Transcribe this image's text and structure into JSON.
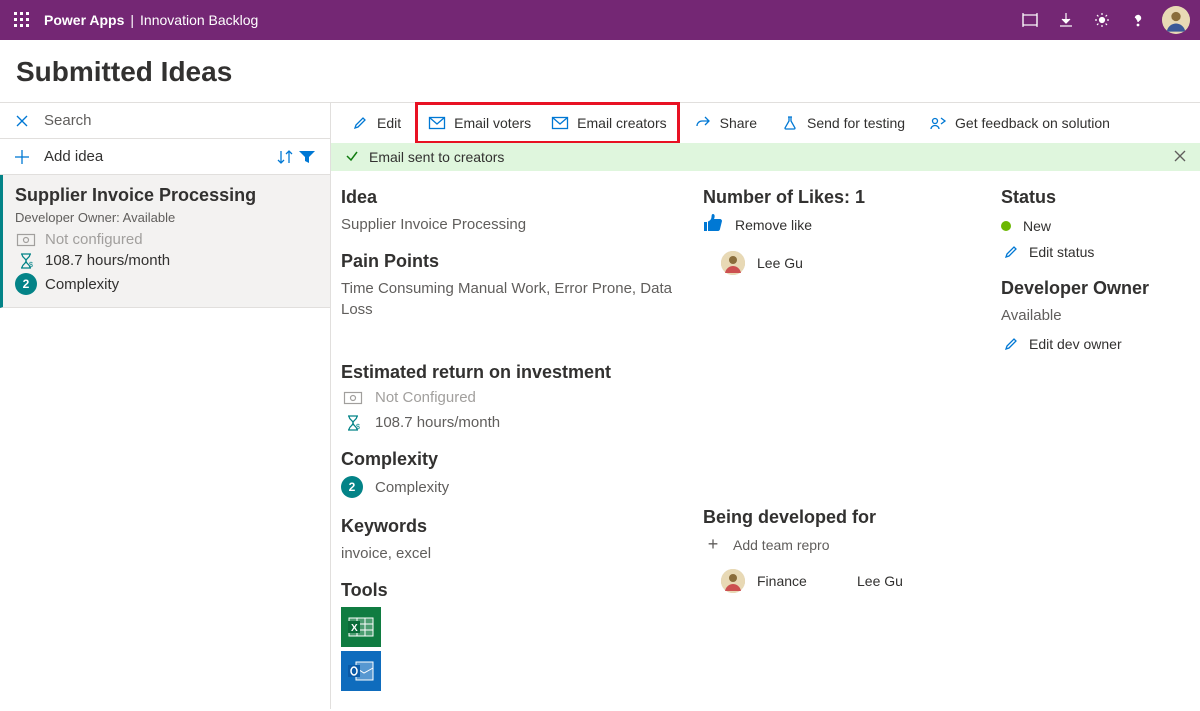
{
  "header": {
    "brand": "Power Apps",
    "app_name": "Innovation Backlog"
  },
  "page_title": "Submitted Ideas",
  "sidebar": {
    "search_placeholder": "Search",
    "add_label": "Add idea",
    "cards": [
      {
        "title": "Supplier Invoice Processing",
        "owner": "Developer Owner: Available",
        "cost": "Not configured",
        "hours": "108.7 hours/month",
        "complexity_n": "2",
        "complexity_label": "Complexity"
      }
    ]
  },
  "commands": {
    "edit": "Edit",
    "email_voters": "Email voters",
    "email_creators": "Email creators",
    "share": "Share",
    "send_for_testing": "Send for testing",
    "get_feedback": "Get feedback on solution"
  },
  "banner": {
    "text": "Email sent to creators"
  },
  "detail": {
    "idea_h": "Idea",
    "idea_v": "Supplier Invoice Processing",
    "pain_h": "Pain Points",
    "pain_v": "Time Consuming Manual Work, Error Prone, Data Loss",
    "roi_h": "Estimated return on investment",
    "roi_cost": "Not Configured",
    "roi_hours": "108.7 hours/month",
    "complex_h": "Complexity",
    "complex_n": "2",
    "complex_v": "Complexity",
    "keywords_h": "Keywords",
    "keywords_v": "invoice, excel",
    "tools_h": "Tools",
    "likes_h": "Number of Likes: 1",
    "remove_like": "Remove like",
    "liker": "Lee Gu",
    "developed_h": "Being developed for",
    "add_team": "Add team repro",
    "dev_team": "Finance",
    "dev_person": "Lee Gu",
    "status_h": "Status",
    "status_v": "New",
    "edit_status": "Edit status",
    "owner_h": "Developer Owner",
    "owner_v": "Available",
    "edit_owner": "Edit dev owner"
  }
}
